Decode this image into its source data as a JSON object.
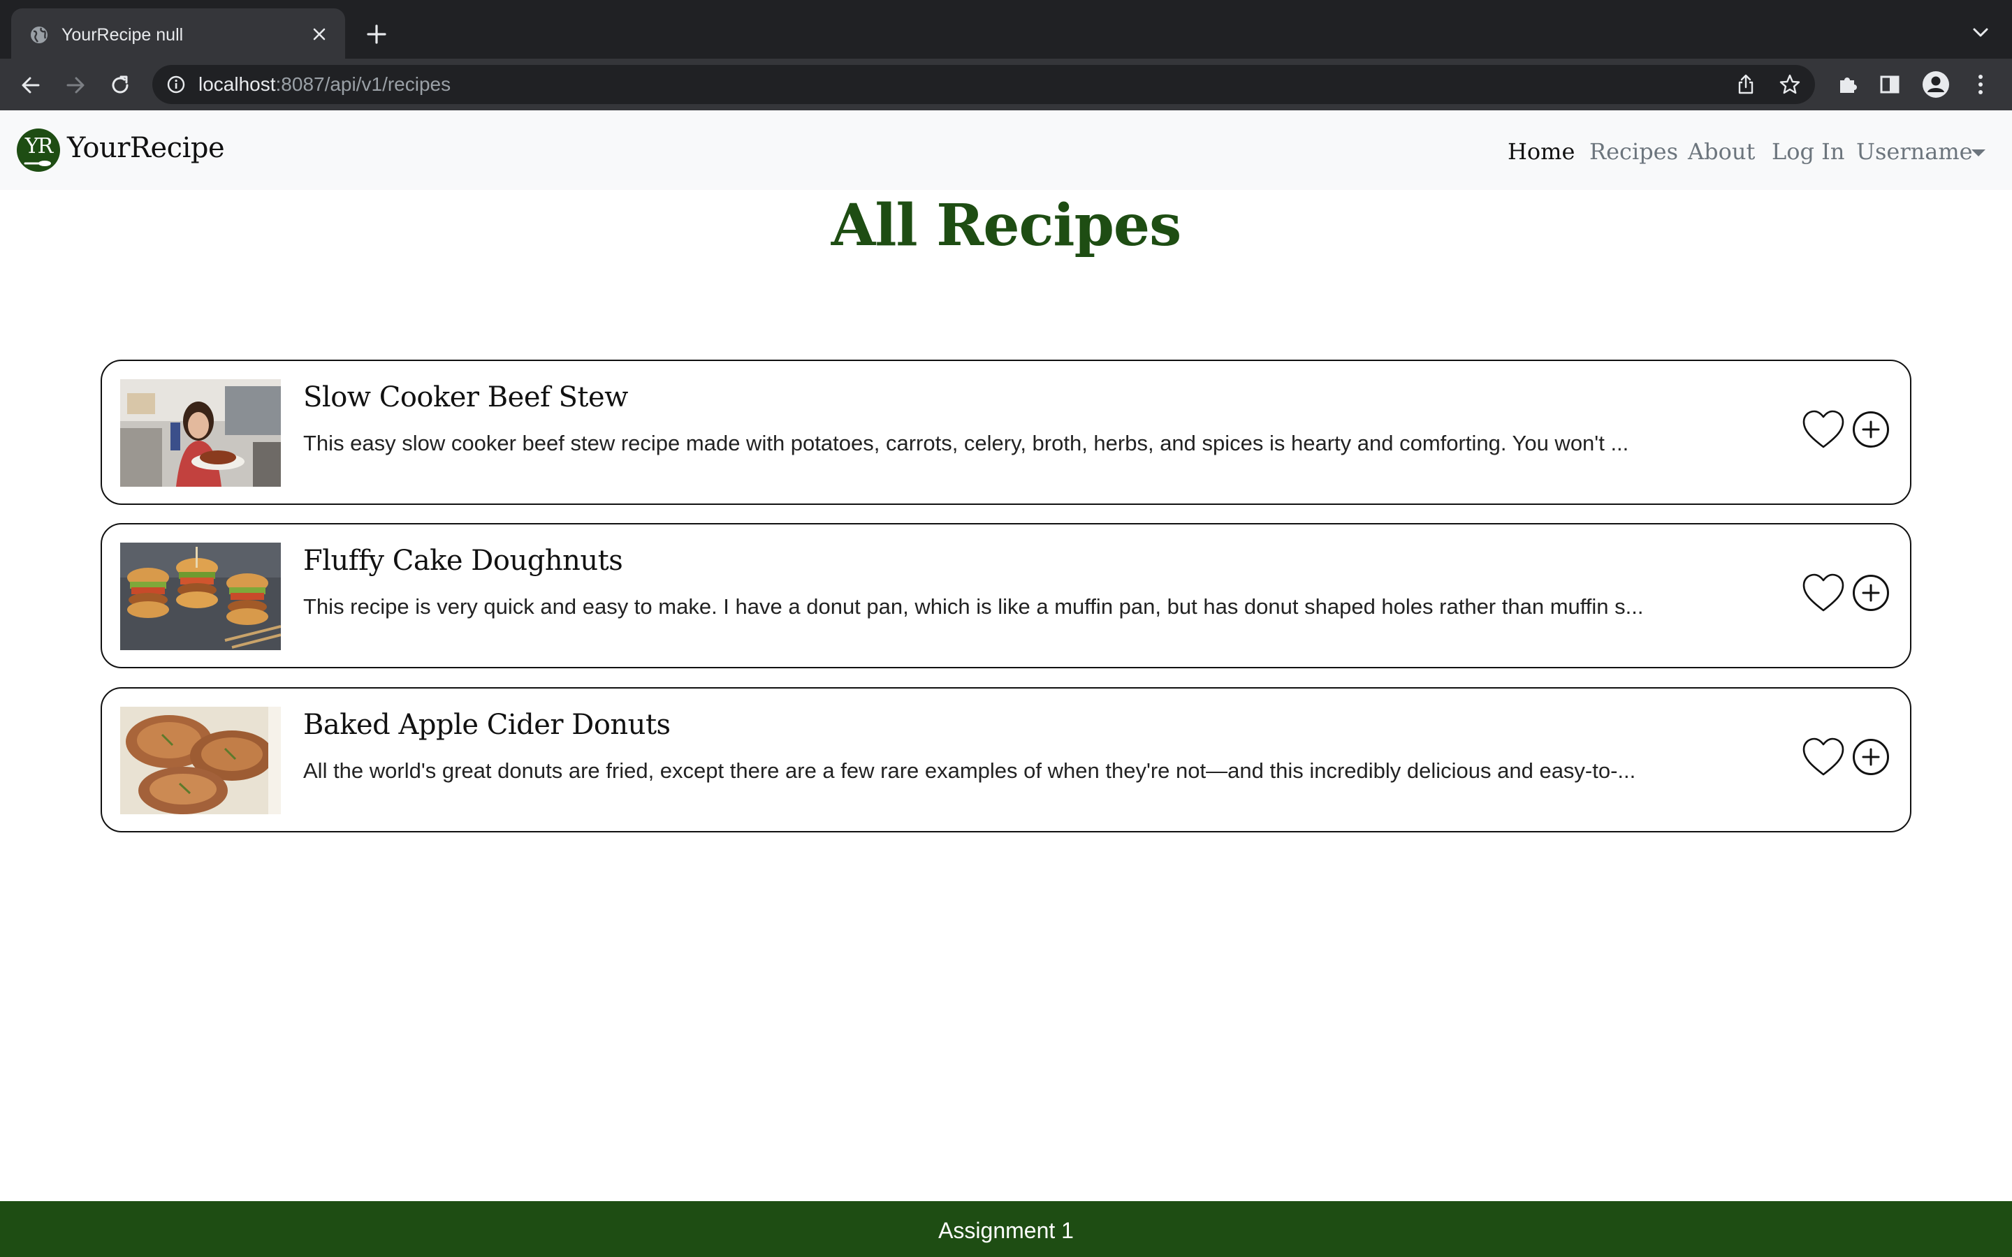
{
  "browser": {
    "tab_title": "YourRecipe null",
    "url_host": "localhost",
    "url_path": ":8087/api/v1/recipes",
    "icons": [
      "globe-icon",
      "close-icon",
      "plus-icon",
      "chevron-down-icon",
      "back-arrow-icon",
      "forward-arrow-icon",
      "reload-icon",
      "info-icon",
      "share-icon",
      "star-icon",
      "puzzle-icon",
      "side-panel-icon",
      "profile-icon",
      "kebab-menu-icon"
    ]
  },
  "navbar": {
    "logo_text": "YR",
    "brand": "YourRecipe",
    "links": [
      "Home",
      "Recipes",
      "About",
      "Log In"
    ],
    "user_dropdown": "Username"
  },
  "main": {
    "title": "All Recipes",
    "recipes": [
      {
        "name": "Slow Cooker Beef Stew",
        "description": "This easy slow cooker beef stew recipe made with potatoes, carrots, celery, broth, herbs, and spices is hearty and comforting. You won't ..."
      },
      {
        "name": "Fluffy Cake Doughnuts",
        "description": "This recipe is very quick and easy to make. I have a donut pan, which is like a muffin pan, but has donut shaped holes rather than muffin s..."
      },
      {
        "name": "Baked Apple Cider Donuts",
        "description": "All the world's great donuts are fried, except there are a few rare examples of when they're not—and this incredibly delicious and easy-to-..."
      }
    ]
  },
  "footer": {
    "text": "Assignment 1"
  },
  "colors": {
    "brand_green": "#1e4d13",
    "chrome_dark": "#202124",
    "chrome_toolbar": "#35363a",
    "navbar_bg": "#f8f9fa"
  }
}
